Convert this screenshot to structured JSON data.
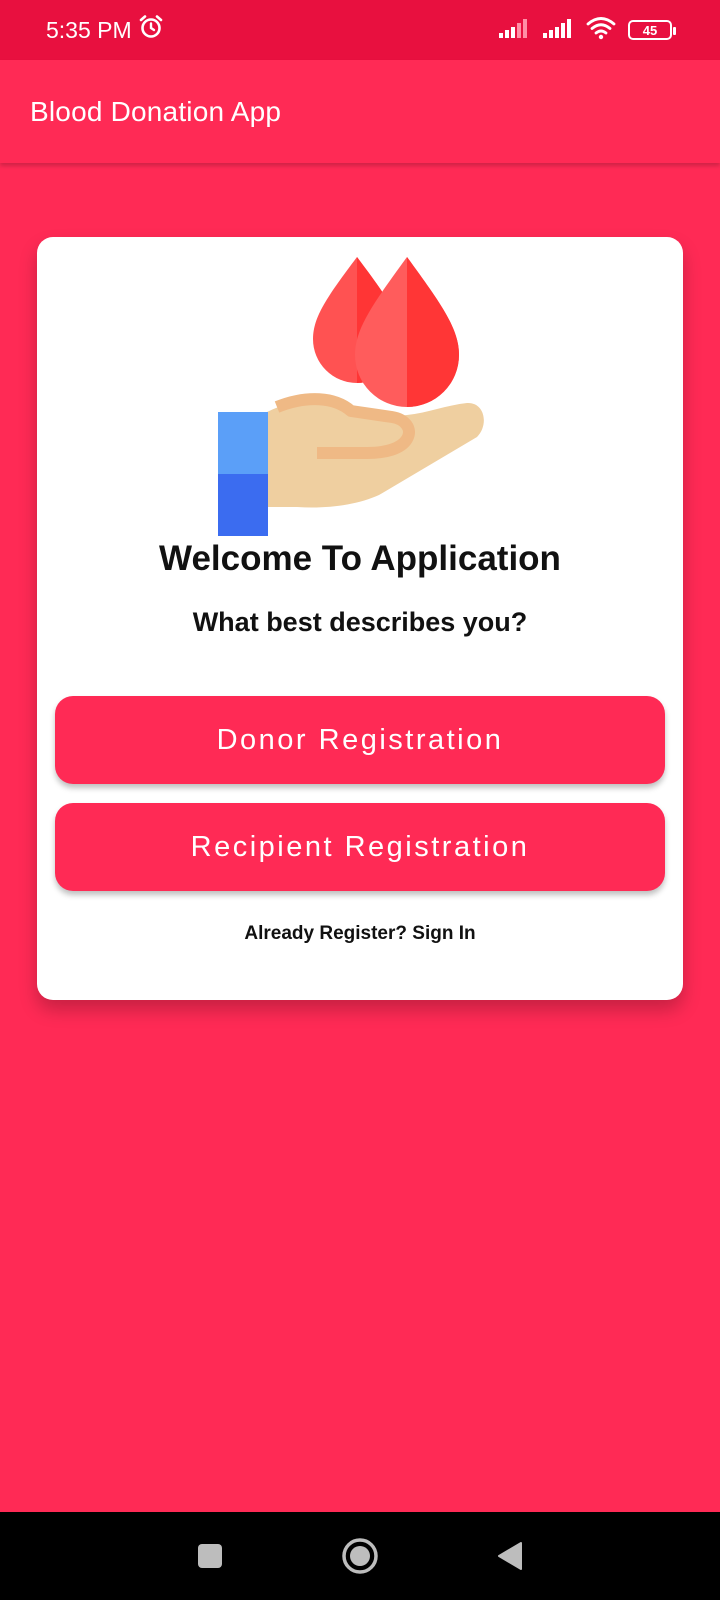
{
  "status_bar": {
    "time": "5:35 PM",
    "icons": [
      "alarm-icon",
      "signal-icon",
      "signal-icon",
      "wifi-icon"
    ],
    "battery": "45"
  },
  "app_bar": {
    "title": "Blood Donation App"
  },
  "card": {
    "illustration": "hand-with-blood-drops",
    "title": "Welcome To Application",
    "subtitle": "What best describes you?",
    "donor_button": "Donor Registration",
    "recipient_button": "Recipient Registration",
    "signin_text": "Already Register? Sign In"
  },
  "nav_bar": {
    "icons": [
      "recents-icon",
      "home-icon",
      "back-icon"
    ]
  },
  "colors": {
    "primary": "#ff2a55",
    "status_bar": "#e8103f",
    "card": "#ffffff",
    "text": "#111111"
  }
}
